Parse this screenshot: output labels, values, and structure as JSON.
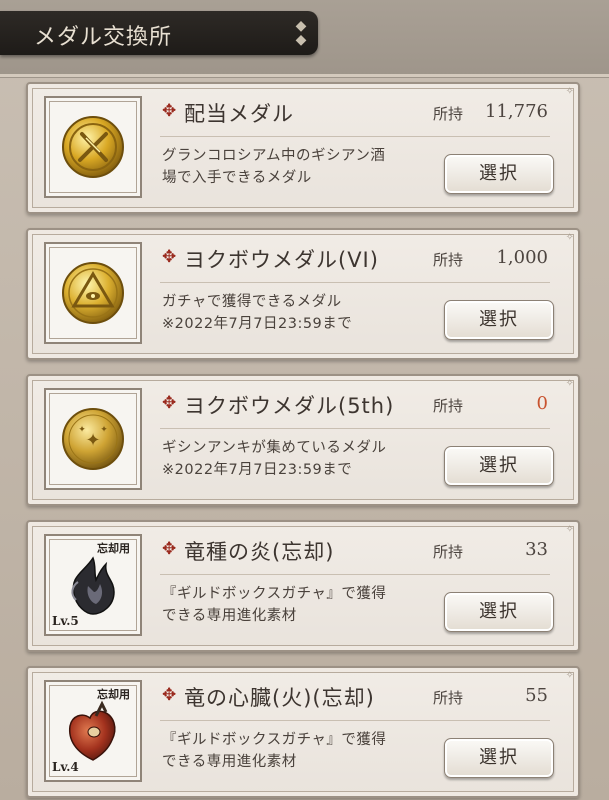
{
  "header": {
    "title": "メダル交換所"
  },
  "owned_label": "所持",
  "select_label": "選択",
  "items": [
    {
      "name": "配当メダル",
      "owned": "11,776",
      "desc_line1": "グランコロシアム中のギシアン酒",
      "desc_line2": "場で入手できるメダル",
      "icon": "gold-medal-crossed-swords-icon"
    },
    {
      "name": "ヨクボウメダル(VI)",
      "owned": "1,000",
      "desc_line1": "ガチャで獲得できるメダル",
      "desc_line2": "※2022年7月7日23:59まで",
      "icon": "gold-medal-eye-triangle-icon"
    },
    {
      "name": "ヨクボウメダル(5th)",
      "owned": "0",
      "desc_line1": "ギシンアンキが集めているメダル",
      "desc_line2": "※2022年7月7日23:59まで",
      "icon": "gold-medal-stars-icon"
    },
    {
      "name": "竜種の炎(忘却)",
      "owned": "33",
      "desc_line1": "『ギルドボックスガチャ』で獲得",
      "desc_line2": "できる専用進化素材",
      "icon": "dark-flame-icon",
      "badge_top": "忘却用",
      "badge_level": "Lv.5"
    },
    {
      "name": "竜の心臓(火)(忘却)",
      "owned": "55",
      "desc_line1": "『ギルドボックスガチャ』で獲得",
      "desc_line2": "できる専用進化素材",
      "icon": "dragon-heart-icon",
      "badge_top": "忘却用",
      "badge_level": "Lv.4"
    }
  ],
  "colors": {
    "accent_bullet": "#9a2a1e",
    "zero_value": "#c8532f",
    "card_bg": "#f1ece6",
    "header_bar": "#1e1b18"
  }
}
